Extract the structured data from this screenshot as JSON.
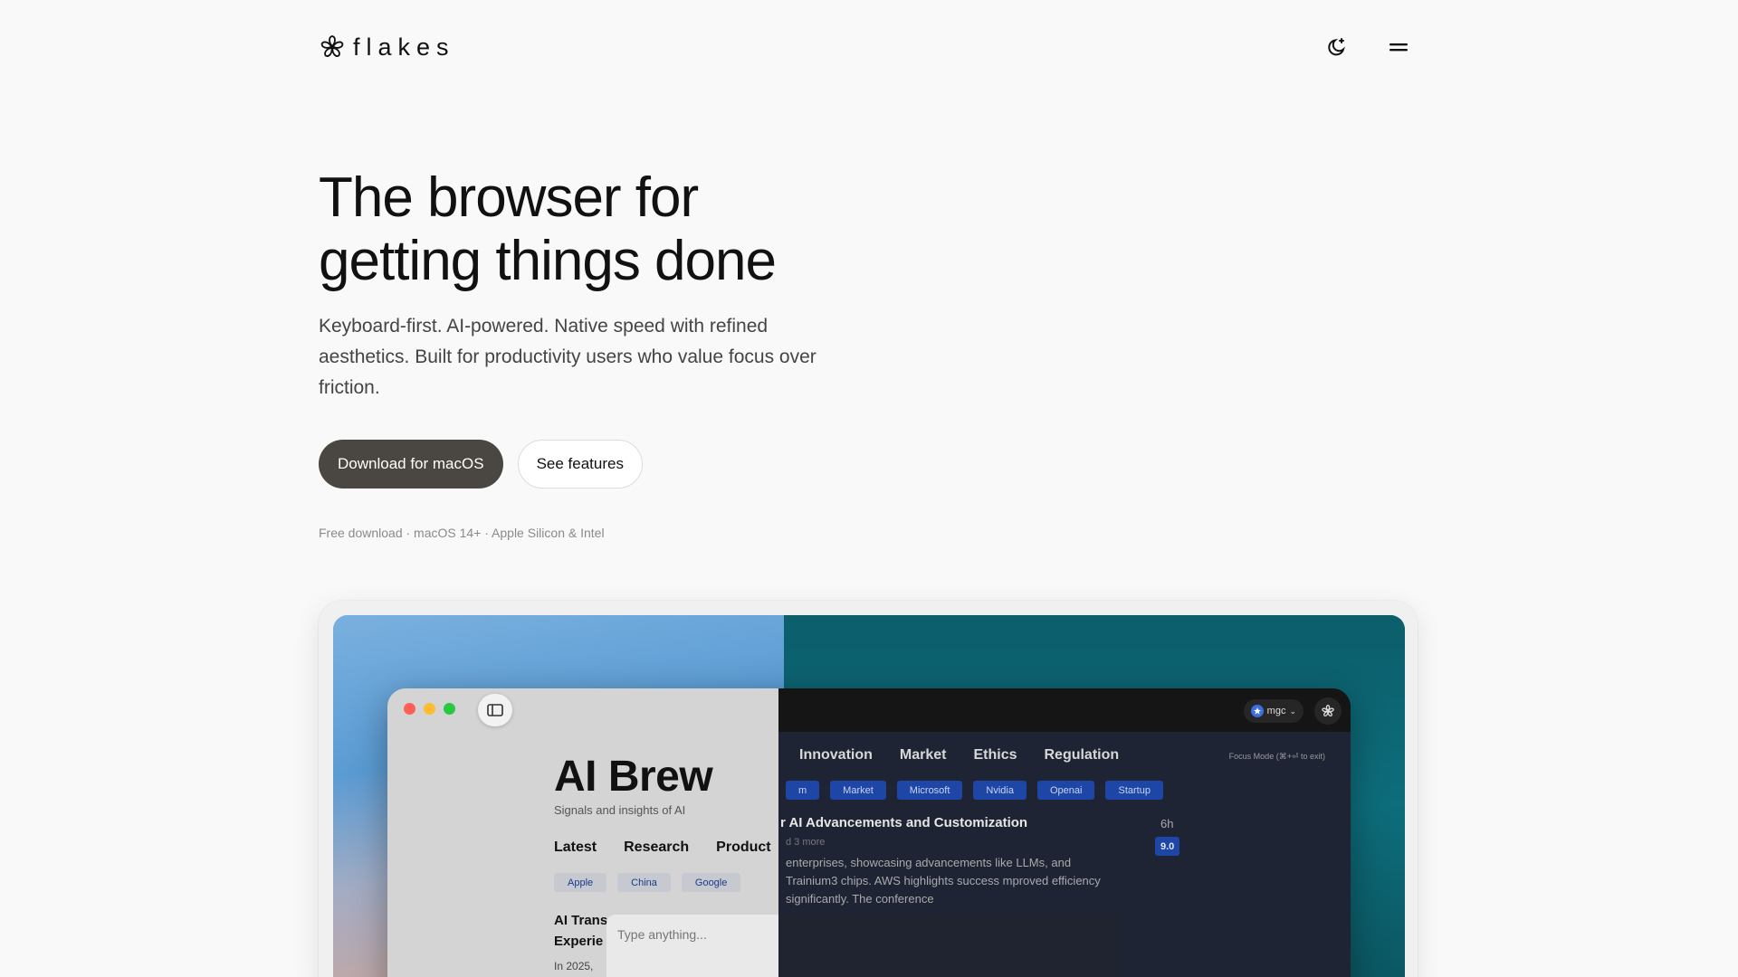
{
  "brand": {
    "name": "flakes",
    "logo_icon": "flake-logo-icon"
  },
  "header": {
    "theme_toggle_icon": "moon-sparkle-icon",
    "menu_icon": "hamburger-menu-icon"
  },
  "hero": {
    "title_line1": "The browser for",
    "title_line2": "getting things done",
    "subtitle": "Keyboard-first. AI-powered. Native speed with refined aesthetics. Built for productivity users who value focus over friction.",
    "primary_cta": "Download for macOS",
    "secondary_cta": "See features",
    "fineprint": "Free download · macOS 14+ · Apple Silicon & Intel"
  },
  "preview": {
    "site_title": "AI Brew",
    "site_tagline": "Signals and insights of AI",
    "nav_light": [
      "Latest",
      "Research",
      "Product"
    ],
    "nav_dark": [
      "Innovation",
      "Market",
      "Ethics",
      "Regulation"
    ],
    "tags_light": [
      "Apple",
      "China",
      "Google"
    ],
    "tags_dark": [
      "m",
      "Market",
      "Microsoft",
      "Nvidia",
      "Openai",
      "Startup"
    ],
    "profile_label": "mgc",
    "focus_hint": "Focus Mode (⌘+⏎ to exit)",
    "article_title_light_1": "AI Trans",
    "article_title_light_2": "Experie",
    "article_meta_light": "In 2025,",
    "article_title_dark": "r AI Advancements and Customization",
    "article_age": "6h",
    "article_score": "9.0",
    "article_more": "d 3 more",
    "article_body_dark": "enterprises, showcasing advancements like LLMs, and Trainium3 chips. AWS highlights success mproved efficiency significantly. The conference",
    "command_placeholder": "Type anything...",
    "colors": {
      "close": "#ff5f57",
      "minimize": "#febc2e",
      "zoom": "#28c840"
    }
  }
}
